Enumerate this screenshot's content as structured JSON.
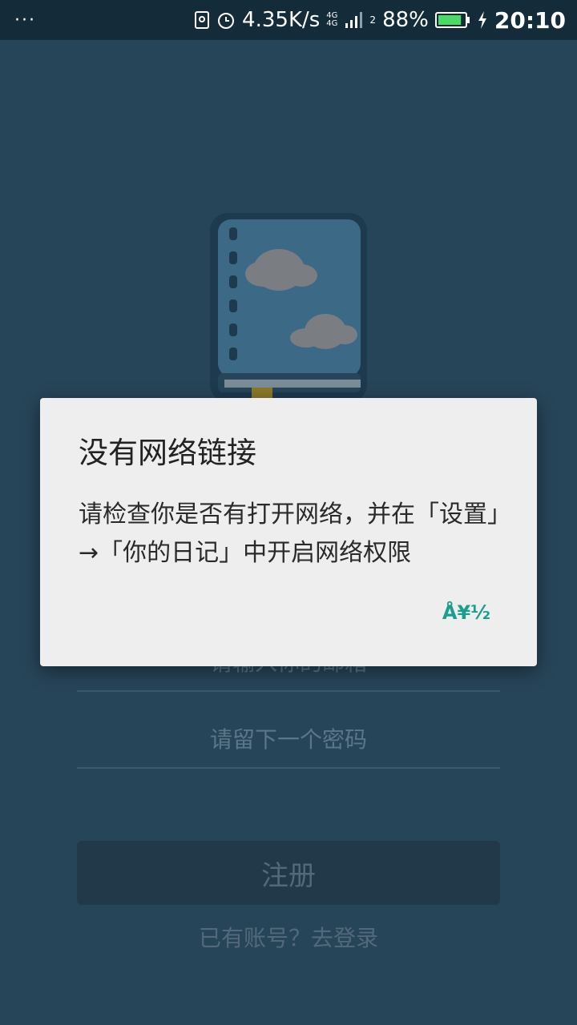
{
  "status_bar": {
    "overflow_dots": "···",
    "network_speed": "4.35K/s",
    "network_type_1": "4G",
    "network_type_2": "4G",
    "sim_slot": "2",
    "battery_percent": "88%",
    "time": "20:10",
    "battery_level": 0.88
  },
  "form": {
    "email_placeholder": "请输入你的邮箱",
    "password_placeholder": "请留下一个密码",
    "register_label": "注册",
    "login_link": "已有账号？去登录"
  },
  "dialog": {
    "title": "没有网络链接",
    "message": "请检查你是否有打开网络，并在「设置」→「你的日记」中开启网络权限",
    "button_label": "Å¥½"
  },
  "colors": {
    "accent": "#1a9e8e",
    "app_background": "#274559",
    "status_bar": "#142b39"
  }
}
